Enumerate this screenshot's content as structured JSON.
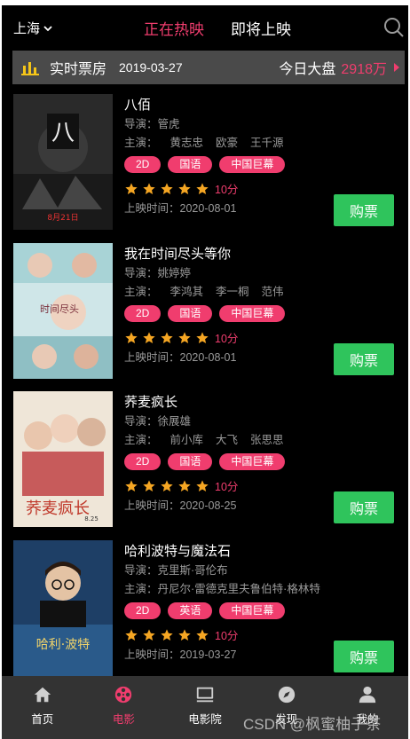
{
  "header": {
    "city": "上海",
    "tabs": [
      {
        "label": "正在热映",
        "active": true
      },
      {
        "label": "即将上映",
        "active": false
      }
    ],
    "search_icon": "search-icon"
  },
  "box_office": {
    "icon": "bar-chart-icon",
    "title": "实时票房",
    "date": "2019-03-27",
    "total_label": "今日大盘",
    "total_value": "2918万"
  },
  "labels": {
    "director": "导演：",
    "cast": "主演：",
    "release": "上映时间：",
    "buy": "购票"
  },
  "movies": [
    {
      "title": "八佰",
      "director": "管虎",
      "cast": [
        "黄志忠",
        "欧豪",
        "王千源"
      ],
      "tags": [
        "2D",
        "国语",
        "中国巨幕"
      ],
      "stars": 5,
      "score": "10分",
      "release": "2020-08-01"
    },
    {
      "title": "我在时间尽头等你",
      "director": "姚婷婷",
      "cast": [
        "李鸿其",
        "李一桐",
        "范伟"
      ],
      "tags": [
        "2D",
        "国语",
        "中国巨幕"
      ],
      "stars": 5,
      "score": "10分",
      "release": "2020-08-01"
    },
    {
      "title": "荞麦疯长",
      "director": "徐展雄",
      "cast": [
        "前小库",
        "大飞",
        "张思思"
      ],
      "tags": [
        "2D",
        "国语",
        "中国巨幕"
      ],
      "stars": 5,
      "score": "10分",
      "release": "2020-08-25"
    },
    {
      "title": "哈利波特与魔法石",
      "director": "克里斯·哥伦布",
      "cast_line": "丹尼尔·雷德克里夫鲁伯特·格林特",
      "tags": [
        "2D",
        "英语",
        "中国巨幕"
      ],
      "stars": 5,
      "score": "10分",
      "release": "2019-03-27"
    }
  ],
  "nav": [
    {
      "label": "首页",
      "icon": "home-icon",
      "active": false
    },
    {
      "label": "电影",
      "icon": "film-reel-icon",
      "active": true
    },
    {
      "label": "电影院",
      "icon": "cinema-screen-icon",
      "active": false
    },
    {
      "label": "发现",
      "icon": "compass-icon",
      "active": false
    },
    {
      "label": "我的",
      "icon": "user-icon",
      "active": false
    }
  ],
  "watermark": "CSDN @枫蜜柚子茶",
  "colors": {
    "accent": "#f03d6e",
    "buy_button": "#2fc45c",
    "star": "#f5a623",
    "background": "#000000",
    "nav_background": "#333333"
  }
}
